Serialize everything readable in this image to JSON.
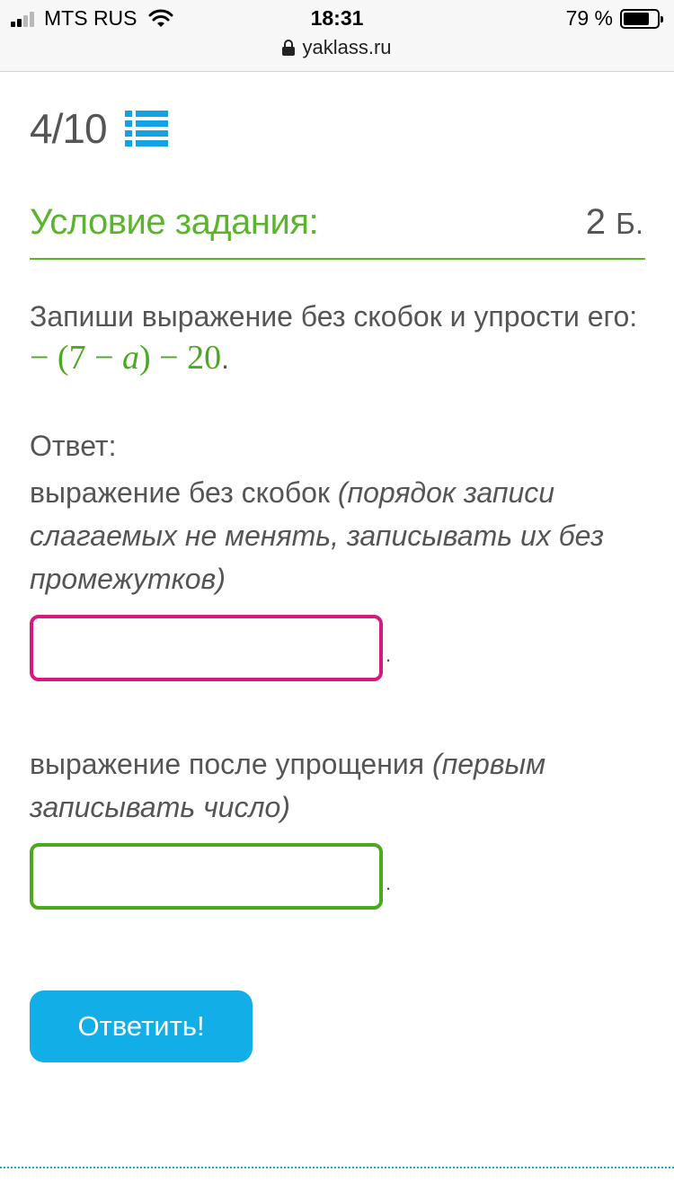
{
  "status_bar": {
    "carrier": "MTS RUS",
    "time": "18:31",
    "battery_text": "79 %",
    "battery_level": 0.79,
    "url": "yaklass.ru"
  },
  "task": {
    "progress": "4/10",
    "title": "Условие задания:",
    "points_value": "2",
    "points_unit": "Б.",
    "question": "Запиши выражение без скобок и упрости его:",
    "formula": {
      "part1": "− (7 − ",
      "variable": "a",
      "part2": ") − 20",
      "end": "."
    }
  },
  "answer": {
    "label": "Ответ:",
    "field1": {
      "label": "выражение без скобок ",
      "hint": "(порядок записи слагаемых не менять, записывать их без промежутков)",
      "value": "",
      "suffix": "."
    },
    "field2": {
      "label": "выражение после упрощения ",
      "hint": "(первым записывать число)",
      "value": "",
      "suffix": "."
    },
    "submit_label": "Ответить!"
  },
  "colors": {
    "accent_green": "#5bb52c",
    "input1_border": "#d6197e",
    "input2_border": "#4aa91f",
    "button_blue": "#12aee8"
  },
  "icons": {
    "progress_list": "list-icon",
    "signal": "signal-icon",
    "wifi": "wifi-icon",
    "battery": "battery-icon",
    "lock": "lock-icon"
  }
}
